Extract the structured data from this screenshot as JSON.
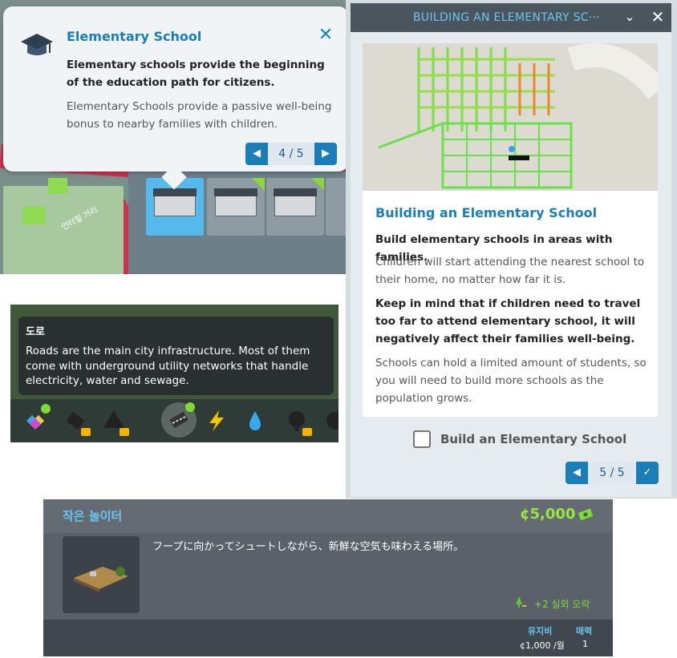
{
  "tooltip_panel": {
    "icon": "graduation-cap-icon",
    "title": "Elementary School",
    "lead": "Elementary schools provide the beginning of the education path for citizens.",
    "body": "Elementary Schools provide a passive well-being bonus to nearby families with children.",
    "pager": "4 / 5",
    "map_label": "언터힐 거리"
  },
  "tutorial_panel": {
    "title": "BUILDING AN ELEMENTARY SC···",
    "heading": "Building an Elementary School",
    "p1": "Build elementary schools in areas with families.",
    "p2": "Children will start attending the nearest school to their home, no matter how far it is.",
    "p3": "Keep in mind that if children need to travel too far to attend elementary school, it will negatively affect their families well-being.",
    "p4": "Schools can hold a limited amount of students, so you will need to build more schools as the population grows.",
    "checkbox_label": "Build an Elementary School",
    "pager": "5 / 5"
  },
  "road_tooltip": {
    "title": "도로",
    "body": "Roads are the main city infrastructure. Most of them come with underground utility networks that handle electricity, water and sewage.",
    "tools": [
      {
        "icon": "zoning-icon",
        "has_dot": true,
        "locked": false
      },
      {
        "icon": "area-icon",
        "has_dot": false,
        "locked": true
      },
      {
        "icon": "landscaping-icon",
        "has_dot": false,
        "locked": true
      },
      {
        "icon": "road-icon",
        "has_dot": true,
        "locked": false
      },
      {
        "icon": "electricity-icon",
        "has_dot": false,
        "locked": false
      },
      {
        "icon": "water-icon",
        "has_dot": false,
        "locked": false
      },
      {
        "icon": "tree-icon",
        "has_dot": false,
        "locked": true
      }
    ]
  },
  "asset_card": {
    "title": "작은 놀이터",
    "price": "¢5,000",
    "description": "フープに向かってシュートしながら、新鮮な空気も味わえる場所。",
    "effect": "+2 실외 오락",
    "upkeep_label": "유지비",
    "upkeep_value": "¢1,000 /월",
    "attractiveness_label": "매력",
    "attractiveness_value": "1"
  },
  "colors": {
    "accent_blue": "#1b7eb8",
    "light_blue": "#67c5f0",
    "green": "#98e63f",
    "road_red": "#c9334f"
  }
}
